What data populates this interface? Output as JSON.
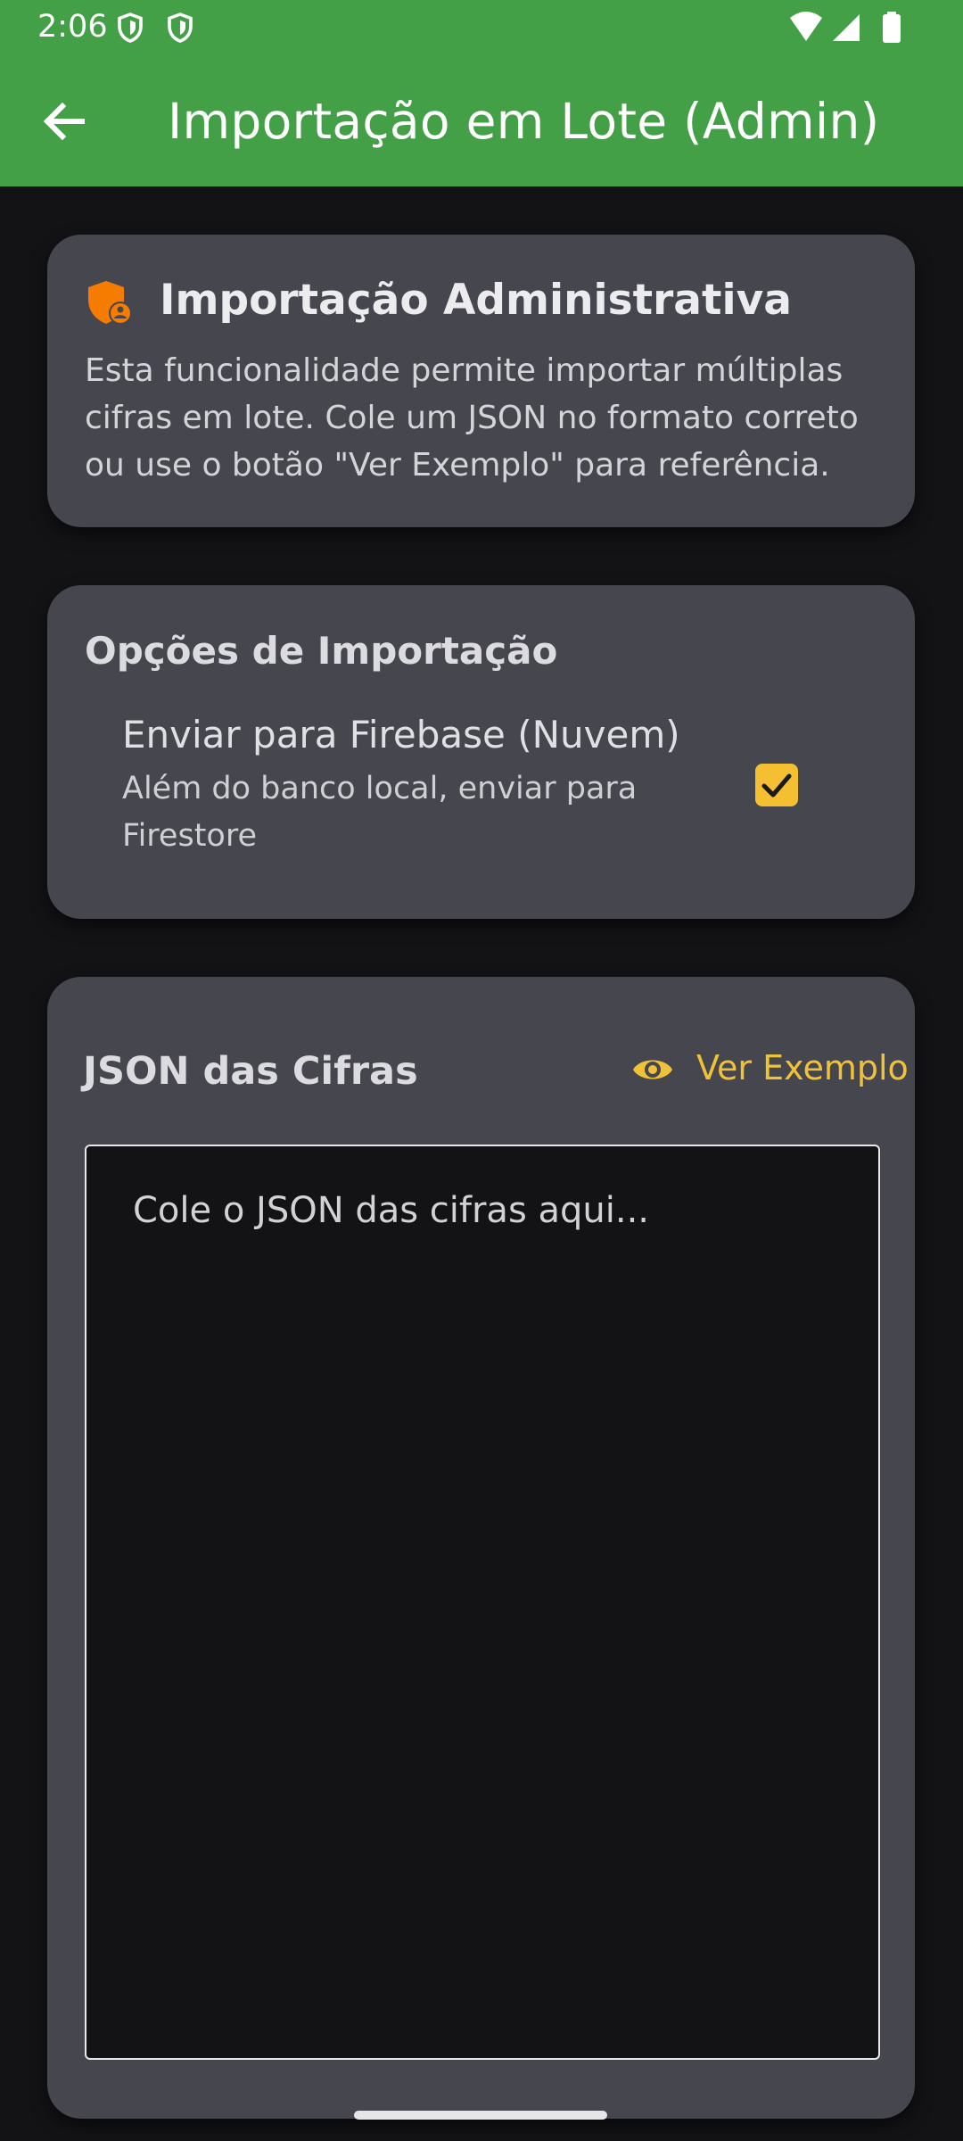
{
  "status_bar": {
    "time": "2:06",
    "icons": [
      "shield-icon",
      "shield-icon",
      "wifi-icon",
      "cellular-signal-icon",
      "battery-icon"
    ]
  },
  "app_bar": {
    "back_icon": "arrow-back-icon",
    "title": "Importação em Lote (Admin)",
    "color": "#43a047"
  },
  "info_card": {
    "icon": "admin-shield-icon",
    "icon_color": "#f57c00",
    "title": "Importação Administrativa",
    "description": "Esta funcionalidade permite importar múltiplas cifras em lote. Cole um JSON no formato correto ou use o botão \"Ver Exemplo\" para referência."
  },
  "options_card": {
    "title": "Opções de Importação",
    "firebase_option": {
      "label": "Enviar para Firebase (Nuvem)",
      "sublabel": "Além do banco local, enviar para Firestore",
      "checked": true
    },
    "accent_color": "#f4c032"
  },
  "json_card": {
    "title": "JSON das Cifras",
    "example_button": {
      "icon": "eye-icon",
      "label": "Ver Exemplo"
    },
    "input": {
      "value": "",
      "placeholder": "Cole o JSON das cifras aqui..."
    }
  },
  "colors": {
    "background": "#131316",
    "card": "#45464e",
    "accent": "#f0c23a"
  }
}
